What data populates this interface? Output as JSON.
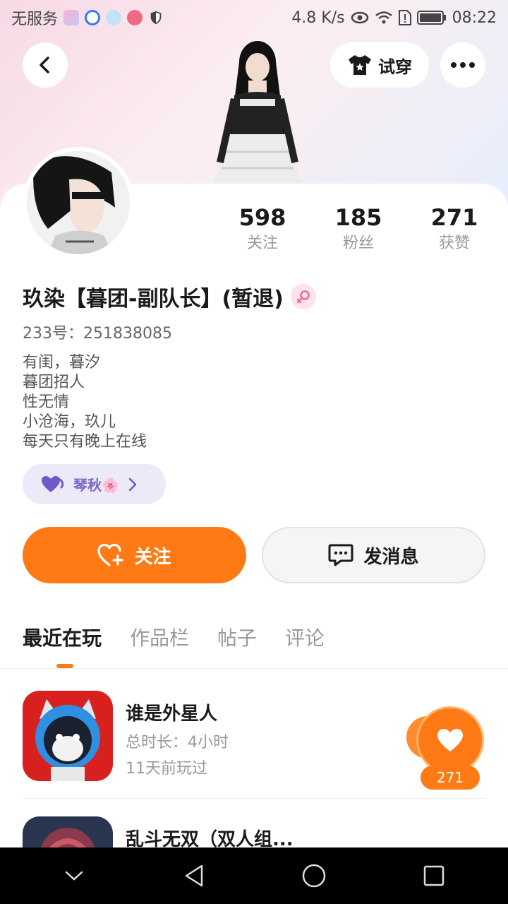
{
  "status_bar": {
    "carrier": "无服务",
    "network_speed": "4.8 K/s",
    "time": "08:22"
  },
  "header": {
    "try_on_label": "试穿"
  },
  "profile": {
    "stats": [
      {
        "value": "598",
        "label": "关注"
      },
      {
        "value": "185",
        "label": "粉丝"
      },
      {
        "value": "271",
        "label": "获赞"
      }
    ],
    "name": "玖染【暮团-副队长】(暂退)",
    "id_text": "233号：251838085",
    "bio_lines": [
      "有闺，暮汐",
      "暮团招人",
      "性无情",
      "小沧海，玖儿",
      "每天只有晚上在线"
    ],
    "tag": {
      "label": "琴秋🌸"
    }
  },
  "actions": {
    "follow_label": "关注",
    "message_label": "发消息"
  },
  "tabs": [
    "最近在玩",
    "作品栏",
    "帖子",
    "评论"
  ],
  "active_tab": "最近在玩",
  "games": [
    {
      "title": "谁是外星人",
      "duration": "总时长：4小时",
      "last_played": "11天前玩过"
    },
    {
      "title": "乱斗无双（双人组..."
    }
  ],
  "like_widget": {
    "count": "271"
  },
  "colors": {
    "accent": "#ff7a14",
    "tag_bg": "#eceaf9",
    "tag_text": "#7a64c9"
  }
}
